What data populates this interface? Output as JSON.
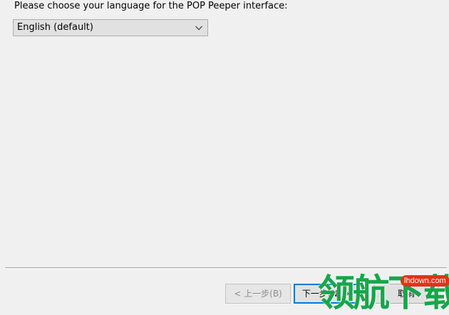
{
  "prompt": "Please choose your language for the POP Peeper interface:",
  "language": {
    "selected": "English (default)",
    "icon": "chevron-down-icon"
  },
  "buttons": {
    "back": "< 上一步(B)",
    "next": "下一步(N) >",
    "cancel": "取消"
  },
  "watermark": {
    "text": "领航下载",
    "url": "lhdown.com"
  },
  "colors": {
    "background": "#f0f0f0",
    "focus": "#0078d7",
    "watermark_green": "#17a64a",
    "watermark_red": "#e2321b"
  }
}
